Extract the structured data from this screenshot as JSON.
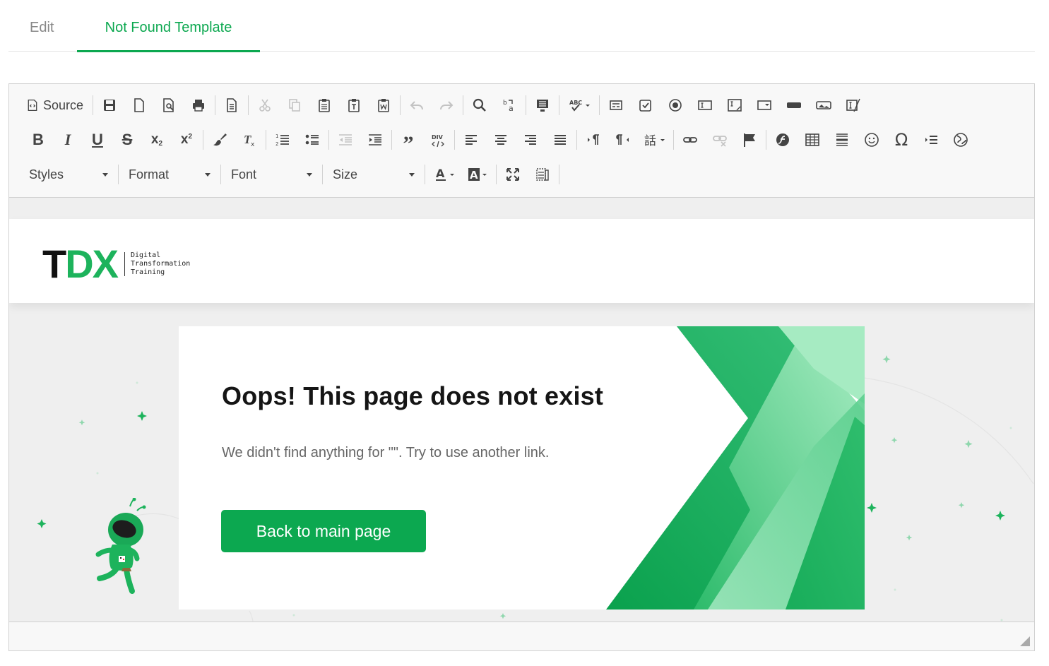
{
  "tabs": [
    {
      "label": "Edit"
    },
    {
      "label": "Not Found Template"
    }
  ],
  "toolbar": {
    "source_label": "Source",
    "combos": {
      "styles": "Styles",
      "format": "Format",
      "font": "Font",
      "size": "Size"
    }
  },
  "page": {
    "logo": {
      "mark_t": "T",
      "mark_dx": "DX",
      "line1": "Digital",
      "line2": "Transformation",
      "line3": "Training"
    },
    "title": "Oops! This page does not exist",
    "message": "We didn't find anything for \"\". Try to use another link.",
    "button_label": "Back to main page"
  },
  "colors": {
    "accent": "#0ca850",
    "brand_green": "#1db35c"
  }
}
